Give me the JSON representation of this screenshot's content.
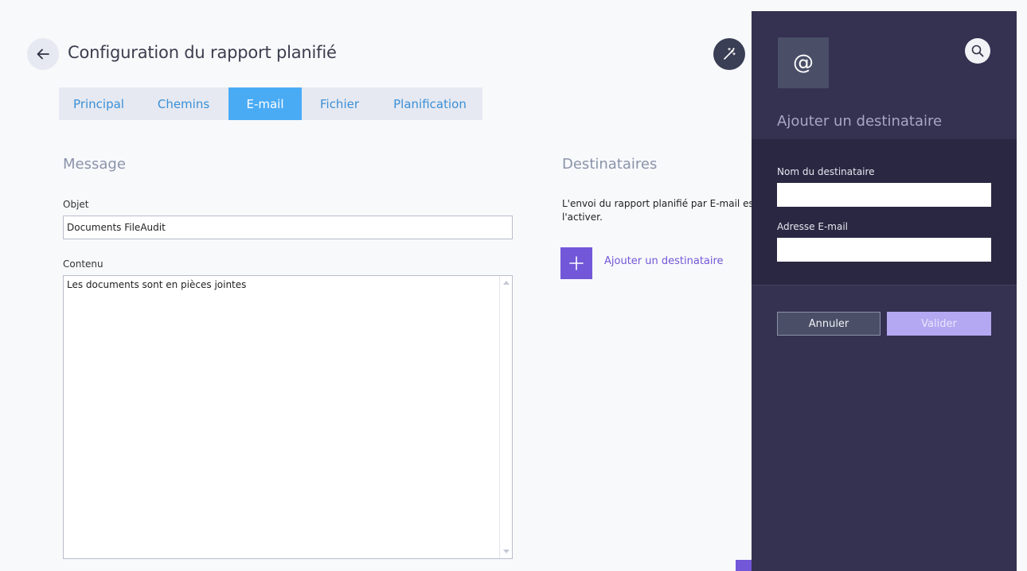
{
  "header": {
    "title": "Configuration du rapport planifié",
    "back_icon": "arrow-left-icon",
    "magic_icon": "magic-wand-icon"
  },
  "tabs": [
    {
      "label": "Principal",
      "active": false
    },
    {
      "label": "Chemins",
      "active": false
    },
    {
      "label": "E-mail",
      "active": true
    },
    {
      "label": "Fichier",
      "active": false
    },
    {
      "label": "Planification",
      "active": false
    }
  ],
  "message": {
    "section_title": "Message",
    "subject_label": "Objet",
    "subject_value": "Documents FileAudit",
    "content_label": "Contenu",
    "content_value": "Les documents sont en pièces jointes"
  },
  "recipients": {
    "section_title": "Destinataires",
    "description_line1": "L'envoi du rapport planifié par E-mail est",
    "description_line2": "l'activer.",
    "add_label": "Ajouter un destinataire"
  },
  "panel": {
    "icon": "at-sign-icon",
    "icon_glyph": "@",
    "title": "Ajouter un destinataire",
    "name_label": "Nom du destinataire",
    "name_value": "",
    "email_label": "Adresse E-mail",
    "email_value": "",
    "cancel_label": "Annuler",
    "validate_label": "Valider"
  },
  "colors": {
    "accent_blue": "#4aabf5",
    "accent_purple": "#7257d8",
    "panel_bg": "#343151",
    "panel_form_bg": "#2a2742"
  }
}
